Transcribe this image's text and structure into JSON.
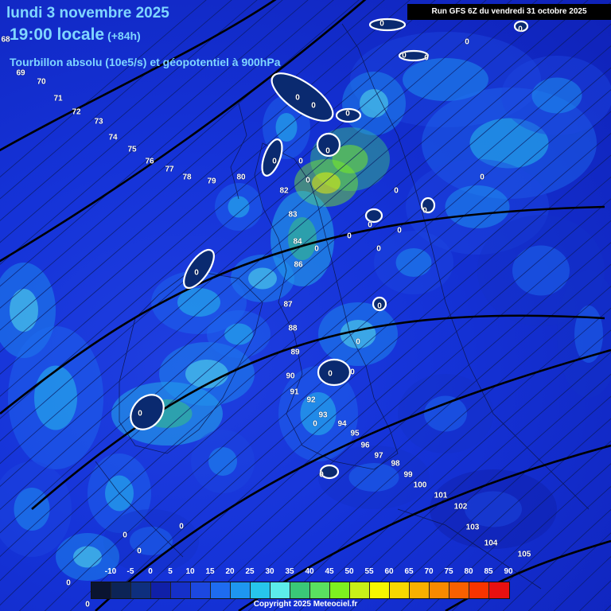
{
  "header": {
    "date": "lundi 3 novembre 2025",
    "time": "19:00 locale",
    "lead": "(+84h)",
    "parameter": "Tourbillon absolu (10e5/s) et géopotentiel à 900hPa"
  },
  "run_info": "Run GFS 6Z du vendredi 31 octobre 2025",
  "copyright": "Copyright 2025 Meteociel.fr",
  "legend": {
    "ticks": [
      "-10",
      "-5",
      "0",
      "5",
      "10",
      "15",
      "20",
      "25",
      "30",
      "35",
      "40",
      "45",
      "50",
      "55",
      "60",
      "65",
      "70",
      "75",
      "80",
      "85",
      "90"
    ],
    "colors": [
      "#0a1430",
      "#0c2456",
      "#0e2f7e",
      "#1020a8",
      "#1530c8",
      "#1c48e0",
      "#1e6cf0",
      "#1e96f0",
      "#27c6ec",
      "#5cecea",
      "#3ac878",
      "#5ae060",
      "#7ef020",
      "#c8f018",
      "#f6f600",
      "#f8d800",
      "#f8b000",
      "#f88a00",
      "#f86000",
      "#f83400",
      "#e81010"
    ]
  },
  "geopotential_labels": [
    "68",
    "69",
    "70",
    "71",
    "72",
    "73",
    "74",
    "75",
    "76",
    "77",
    "78",
    "79",
    "80",
    "82",
    "83",
    "84",
    "86",
    "87",
    "88",
    "89",
    "90",
    "91",
    "92",
    "93",
    "94",
    "95",
    "96",
    "97",
    "98",
    "99",
    "100",
    "101",
    "102",
    "103",
    "104",
    "105"
  ],
  "vorticity_labels": [
    "0",
    "0",
    "0",
    "0",
    "0",
    "0",
    "0",
    "0",
    "0",
    "0",
    "0",
    "0",
    "0",
    "0",
    "0",
    "0",
    "0",
    "0",
    "0",
    "0",
    "0",
    "0",
    "0",
    "0",
    "0",
    "0",
    "0",
    "0",
    "0",
    "0",
    "0",
    "0",
    "0"
  ]
}
